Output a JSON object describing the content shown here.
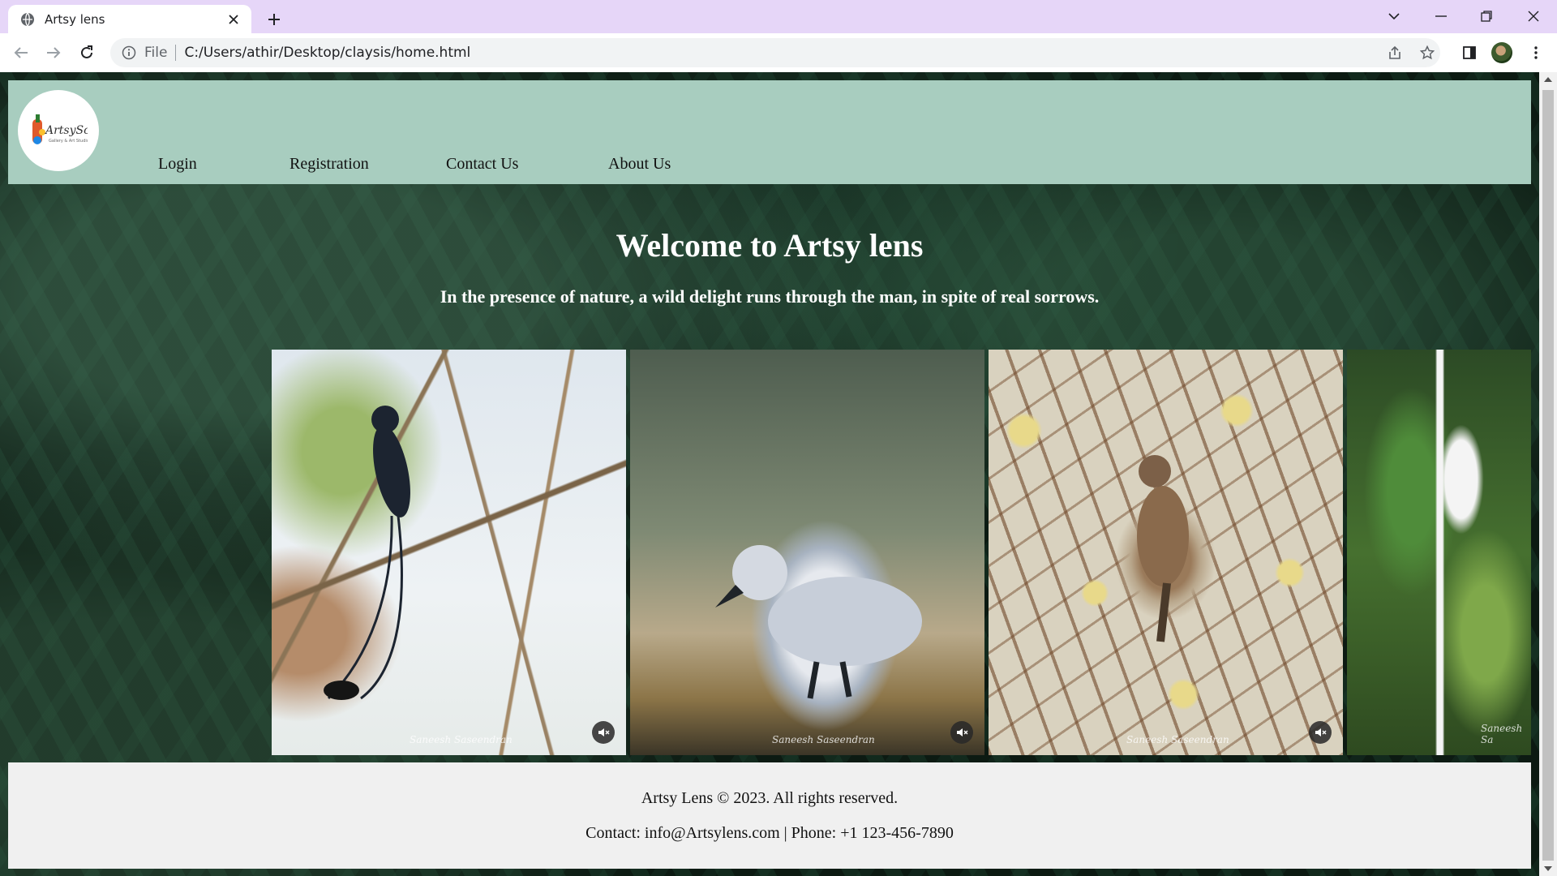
{
  "browser": {
    "tab_title": "Artsy lens",
    "scheme": "File",
    "url": "C:/Users/athir/Desktop/claysis/home.html"
  },
  "site": {
    "nav": [
      "Login",
      "Registration",
      "Contact Us",
      "About Us"
    ],
    "hero": {
      "title": "Welcome to Artsy lens",
      "subtitle": "In the presence of nature, a wild delight runs through the man, in spite of real sorrows."
    },
    "gallery": {
      "photos": [
        {
          "subject": "drongo-bird-on-branch",
          "credit": "Saneesh Saseendran",
          "muted": true
        },
        {
          "subject": "cygnet-on-shore",
          "credit": "Saneesh Saseendran",
          "muted": true
        },
        {
          "subject": "sparrow-in-thorny-tree",
          "credit": "Saneesh Saseendran",
          "muted": true
        },
        {
          "subject": "paradise-flycatcher",
          "credit": "Saneesh Sa",
          "muted": false
        }
      ]
    },
    "footer": {
      "copyright": "Artsy Lens © 2023. All rights reserved.",
      "contact": "Contact: info@Artsylens.com | Phone: +1 123-456-7890"
    }
  },
  "colors": {
    "tabstrip": "#e6d6f8",
    "header_bg": "#a8cdbf",
    "footer_bg": "#f0f0f0",
    "page_bg": "#0c1a12"
  }
}
